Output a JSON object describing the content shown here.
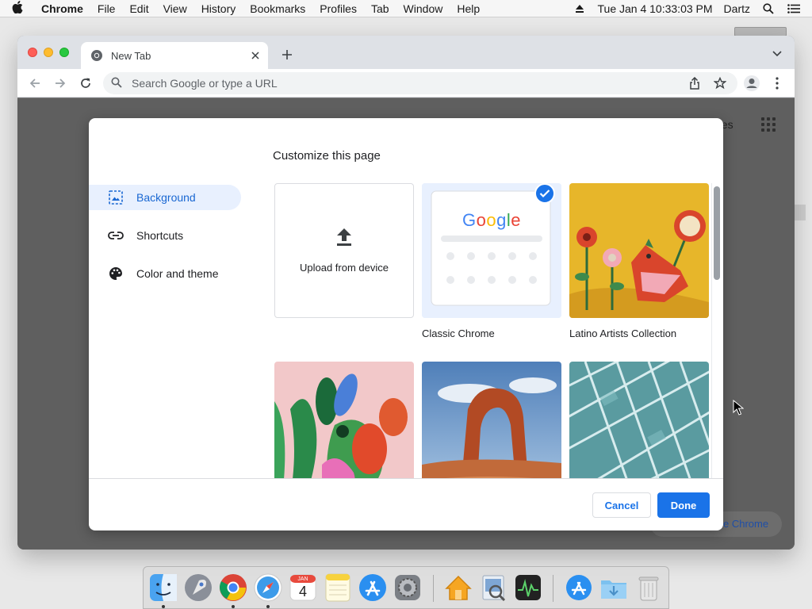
{
  "menubar": {
    "app": "Chrome",
    "menus": [
      "File",
      "Edit",
      "View",
      "History",
      "Bookmarks",
      "Profiles",
      "Tab",
      "Window",
      "Help"
    ],
    "clock": "Tue Jan 4  10:33:03 PM",
    "user": "Dartz"
  },
  "browser": {
    "tab_title": "New Tab",
    "omnibox_placeholder": "Search Google or type a URL",
    "page_partial_text": "ges",
    "customize_pill_partial": "e Chrome"
  },
  "dialog": {
    "title": "Customize this page",
    "sidebar": [
      {
        "label": "Background",
        "icon": "image-icon",
        "active": true
      },
      {
        "label": "Shortcuts",
        "icon": "link-icon",
        "active": false
      },
      {
        "label": "Color and theme",
        "icon": "palette-icon",
        "active": false
      }
    ],
    "tiles": {
      "upload_label": "Upload from device",
      "classic_label": "Classic Chrome",
      "classic_logo": "Google",
      "latino_label": "Latino Artists Collection"
    },
    "cancel_label": "Cancel",
    "done_label": "Done"
  },
  "dock": {
    "calendar_month": "JAN",
    "calendar_day": "4",
    "apps": [
      "finder",
      "launchpad",
      "chrome",
      "safari",
      "calendar",
      "notes",
      "app-store",
      "system-preferences",
      "home",
      "preview",
      "activity-monitor",
      "app-store-downloads",
      "downloads-folder",
      "trash"
    ]
  },
  "colors": {
    "accent": "#1a73e8",
    "active_bg": "#e8f0fe"
  }
}
